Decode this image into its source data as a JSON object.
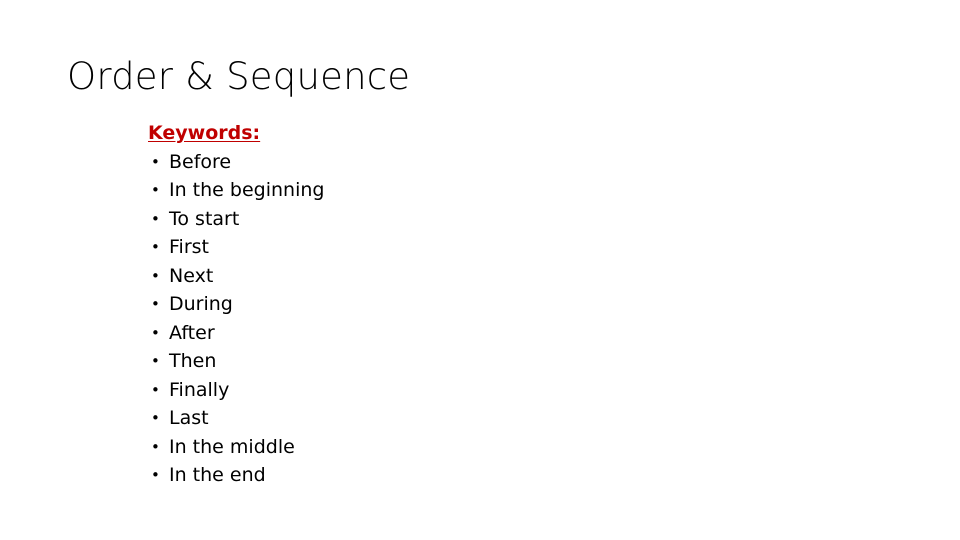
{
  "slide": {
    "title": "Order & Sequence",
    "background_color": "#FFFFFF",
    "body": {
      "heading": "Keywords:",
      "heading_color": "#C00000",
      "bullet_glyph": "•",
      "items": [
        {
          "label": "Before"
        },
        {
          "label": "In the beginning"
        },
        {
          "label": "To start"
        },
        {
          "label": "First"
        },
        {
          "label": "Next"
        },
        {
          "label": "During"
        },
        {
          "label": "After"
        },
        {
          "label": "Then"
        },
        {
          "label": "Finally"
        },
        {
          "label": "Last"
        },
        {
          "label": "In the middle"
        },
        {
          "label": "In the end"
        }
      ]
    }
  }
}
